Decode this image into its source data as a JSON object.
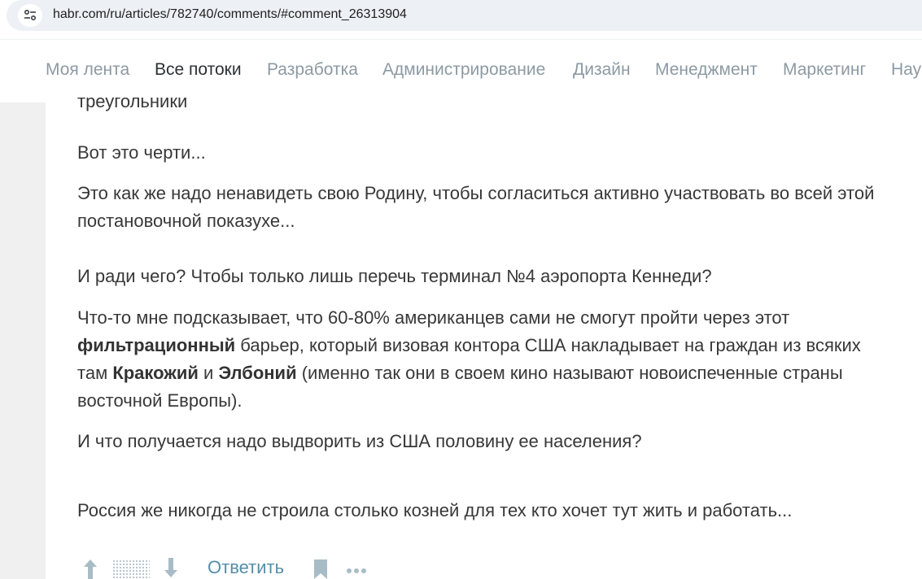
{
  "browser": {
    "url": "habr.com/ru/articles/782740/comments/#comment_26313904"
  },
  "nav": {
    "items": [
      {
        "label": "Моя лента"
      },
      {
        "label": "Все потоки"
      },
      {
        "label": "Разработка"
      },
      {
        "label": "Администрирование"
      },
      {
        "label": "Дизайн"
      },
      {
        "label": "Менеджмент"
      },
      {
        "label": "Маркетинг"
      },
      {
        "label": "Нау"
      }
    ],
    "active_index": 1
  },
  "comment": {
    "cut_text": "треугольники",
    "paragraphs": {
      "p1": "Вот это черти...",
      "p2": "Это как же надо ненавидеть свою Родину, чтобы согласиться активно участвовать во всей этой постановочной показухе...",
      "p3": "И ради чего? Чтобы только лишь перечь терминал №4 аэропорта Кеннеди?",
      "p4_a": "Что-то мне подсказывает, что 60-80% американцев сами не смогут пройти через этот ",
      "p4_b": "фильтрационный",
      "p4_c": " барьер, который визовая контора США накладывает на граждан из всяких там ",
      "p4_d": "Кракожий",
      "p4_e": " и ",
      "p4_f": "Элбоний",
      "p4_g": " (именно так они в своем кино называют новоиспеченные страны восточной Европы).",
      "p5": "И что получается надо выдворить из США половину ее населения?",
      "p6": "Россия же никогда не строила столько козней для тех кто хочет тут жить и работать..."
    }
  },
  "actions": {
    "reply_label": "Ответить"
  },
  "icons": {
    "site_info": "tune-icon",
    "vote_up": "arrow-up-icon",
    "vote_down": "arrow-down-icon",
    "bookmark": "bookmark-icon",
    "more": "more-horizontal-icon"
  },
  "colors": {
    "link": "#548eaa",
    "text": "#383838",
    "nav_inactive": "#8d9aa3",
    "nav_active": "#2d3135",
    "icon": "#a8bcc6"
  }
}
